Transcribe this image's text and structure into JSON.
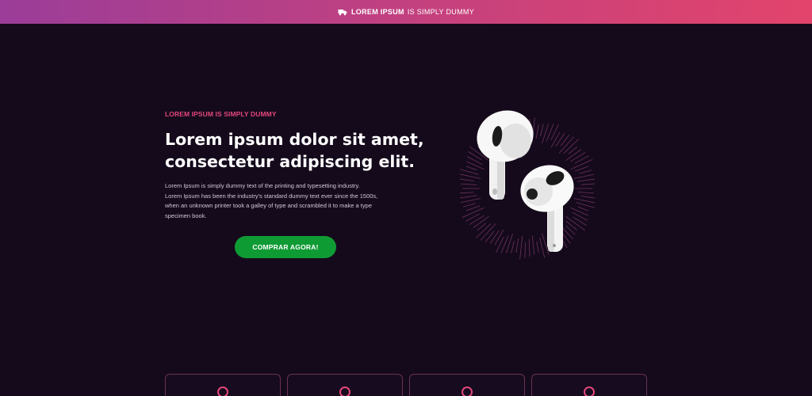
{
  "announcement": {
    "icon": "truck-icon",
    "bold_text": "LOREM IPSUM",
    "text": "IS SIMPLY DUMMY",
    "gradient_start": "#9b3d99",
    "gradient_end": "#e2446c"
  },
  "hero": {
    "eyebrow": "LOREM IPSUM IS SIMPLY DUMMY",
    "headline_line1": "Lorem ipsum dolor sit amet,",
    "headline_line2": "consectetur adipiscing elit.",
    "body_lines": [
      "Lorem Ipsum is simply dummy text of the printing and typesetting industry.",
      "Lorem Ipsum has been the industry's standard dummy text ever since the 1500s,",
      "when an unknown printer took a galley of type and scrambled it to make a type",
      "specimen book."
    ],
    "cta_label": "COMPRAR AGORA!",
    "cta_color": "#0f9b34",
    "accent_color": "#e2477b",
    "product_image": "earbuds-image"
  },
  "feature_cards": [
    {
      "icon": "pin-icon"
    },
    {
      "icon": "pin-icon"
    },
    {
      "icon": "pin-icon"
    },
    {
      "icon": "pin-icon"
    }
  ],
  "colors": {
    "background": "#150a1c",
    "card_border": "#6a3253"
  }
}
